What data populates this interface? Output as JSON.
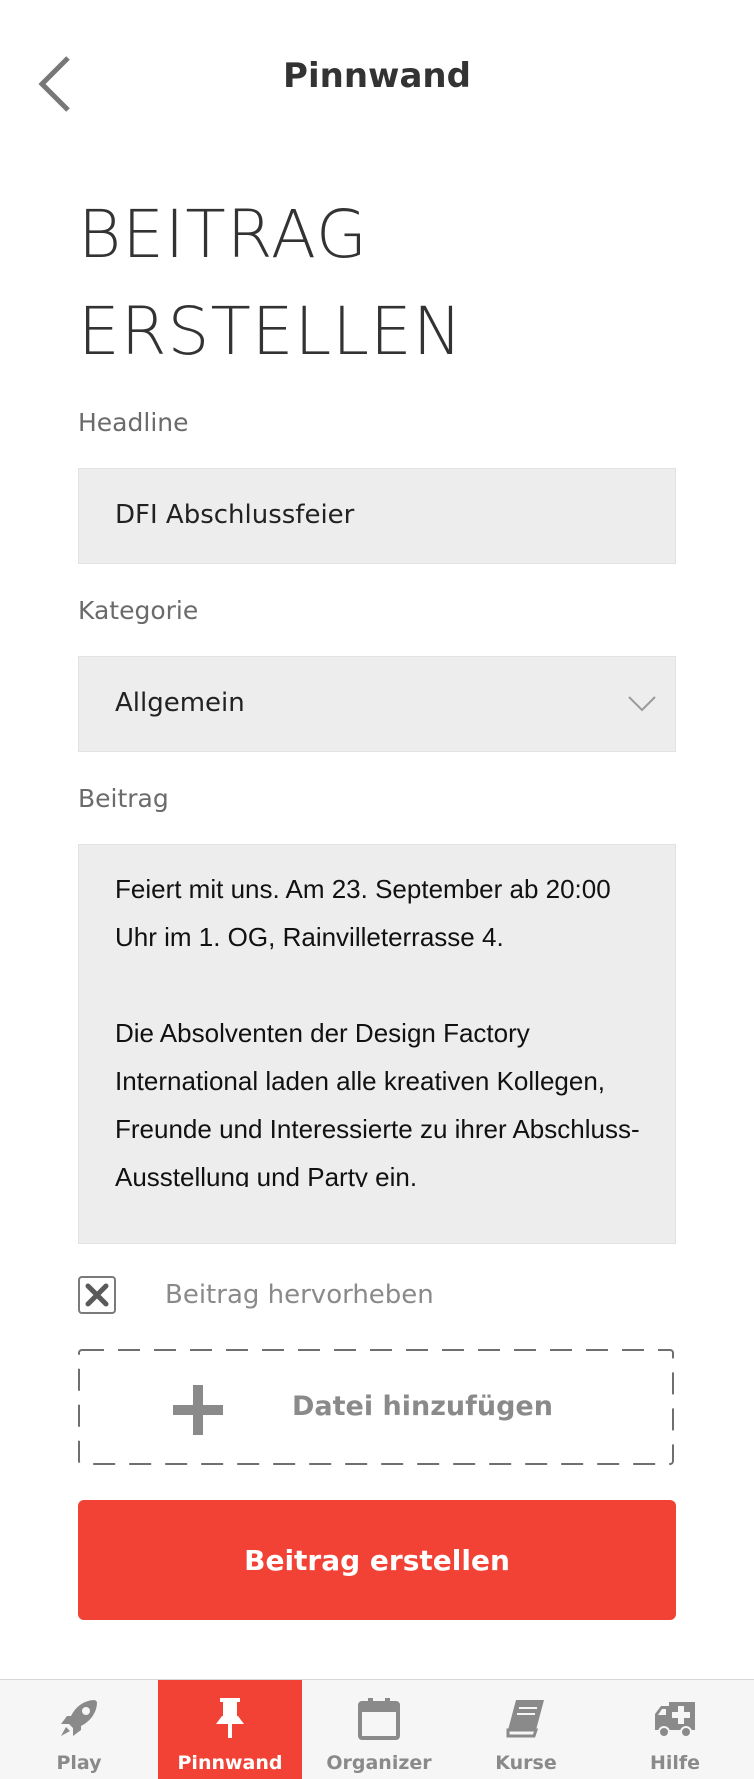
{
  "header": {
    "title": "Pinnwand"
  },
  "form": {
    "heading_line1": "BEITRAG",
    "heading_line2": "ERSTELLEN",
    "headline_label": "Headline",
    "headline_value": "DFI Abschlussfeier",
    "category_label": "Kategorie",
    "category_value": "Allgemein",
    "post_label": "Beitrag",
    "post_value": "Feiert mit uns. Am 23. September ab 20:00 Uhr im 1. OG, Rainvilleterrasse 4.\n\nDie Absolventen der Design Factory International laden alle kreativen Kollegen, Freunde und Interessierte zu ihrer Abschluss-Ausstellung und Party ein.",
    "highlight_label": "Beitrag hervorheben",
    "highlight_checked": true,
    "add_file_label": "Datei hinzufügen",
    "submit_label": "Beitrag erstellen"
  },
  "tabbar": {
    "items": [
      {
        "label": "Play",
        "icon": "rocket-icon"
      },
      {
        "label": "Pinnwand",
        "icon": "pushpin-icon",
        "active": true
      },
      {
        "label": "Organizer",
        "icon": "calendar-icon"
      },
      {
        "label": "Kurse",
        "icon": "book-icon"
      },
      {
        "label": "Hilfe",
        "icon": "ambulance-icon"
      }
    ]
  },
  "colors": {
    "accent": "#f24236",
    "field_bg": "#ededed",
    "muted": "#8a8a8a"
  }
}
